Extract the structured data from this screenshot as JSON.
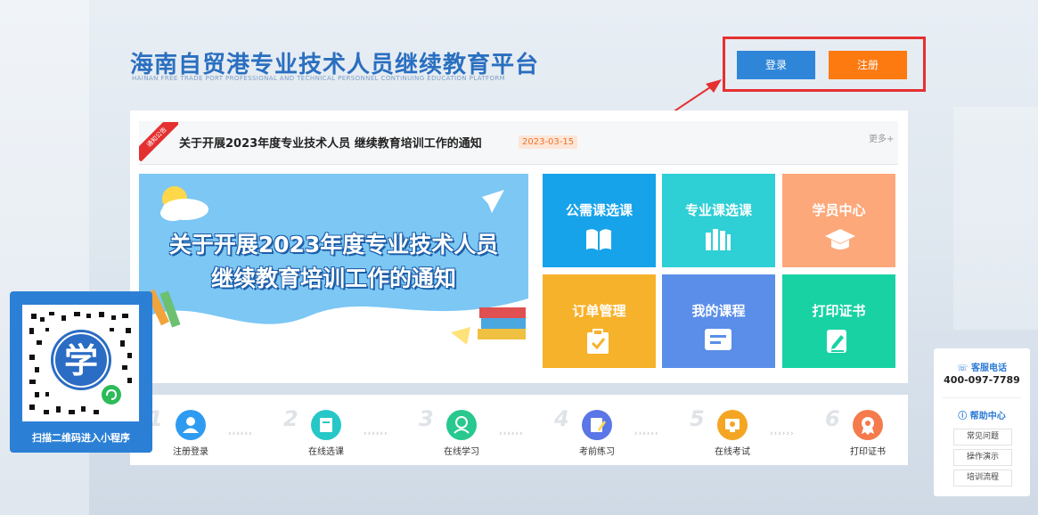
{
  "header": {
    "title": "海南自贸港专业技术人员继续教育平台",
    "subtitle": "HAINAN FREE TRADE PORT PROFESSIONAL AND TECHNICAL PERSONNEL CONTINUING EDUCATION PLATFORM",
    "login_label": "登录",
    "register_label": "注册"
  },
  "notice": {
    "badge": "通知公告",
    "title": "关于开展2023年度专业技术人员 继续教育培训工作的通知",
    "date": "2023-03-15",
    "more": "更多+"
  },
  "banner": {
    "line1": "关于开展2023年度专业技术人员",
    "line2": "继续教育培训工作的通知"
  },
  "tiles": [
    {
      "label": "公需课选课",
      "icon": "book-icon",
      "color": "#17a3ea"
    },
    {
      "label": "专业课选课",
      "icon": "books-icon",
      "color": "#2ecfd5"
    },
    {
      "label": "学员中心",
      "icon": "graduation-cap-icon",
      "color": "#fda87a"
    },
    {
      "label": "订单管理",
      "icon": "clipboard-check-icon",
      "color": "#f7b22b"
    },
    {
      "label": "我的课程",
      "icon": "course-icon",
      "color": "#5a8ee8"
    },
    {
      "label": "打印证书",
      "icon": "certificate-icon",
      "color": "#18d2a4"
    }
  ],
  "steps": [
    {
      "num": "1",
      "label": "注册登录",
      "icon": "user-icon",
      "color": "#2f9bf0"
    },
    {
      "num": "2",
      "label": "在线选课",
      "icon": "book-icon",
      "color": "#27c7c8"
    },
    {
      "num": "3",
      "label": "在线学习",
      "icon": "learner-icon",
      "color": "#28c88e"
    },
    {
      "num": "4",
      "label": "考前练习",
      "icon": "edit-icon",
      "color": "#5b76e6"
    },
    {
      "num": "5",
      "label": "在线考试",
      "icon": "exam-icon",
      "color": "#f4a623"
    },
    {
      "num": "6",
      "label": "打印证书",
      "icon": "medal-icon",
      "color": "#f57a4c"
    }
  ],
  "step_arrow": "››››››",
  "qr": {
    "label": "扫描二维码进入小程序",
    "center_char": "学"
  },
  "service": {
    "phone_title": "客服电话",
    "phone": "400-097-7789",
    "help_title": "帮助中心",
    "links": [
      "常见问题",
      "操作演示",
      "培训流程"
    ]
  },
  "colors": {
    "primary": "#2f86d8",
    "accent": "#fc7a10",
    "highlight": "#e53030"
  }
}
